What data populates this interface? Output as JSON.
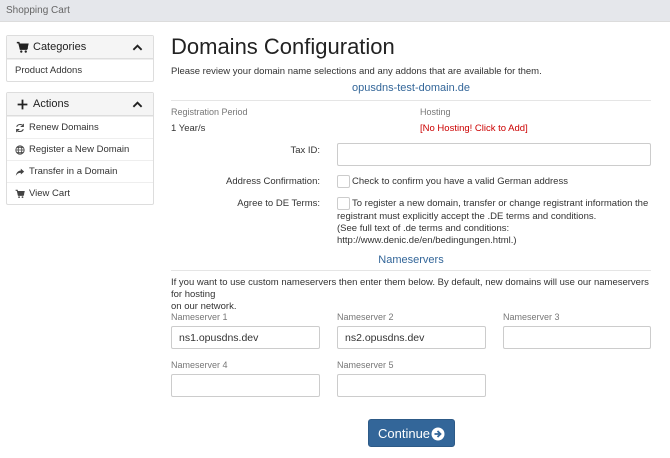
{
  "topbar": {
    "title": "Shopping Cart"
  },
  "sidebar": {
    "categories": {
      "title": "Categories",
      "items": [
        {
          "label": "Product Addons"
        }
      ]
    },
    "actions": {
      "title": "Actions",
      "items": [
        {
          "label": "Renew Domains",
          "icon": "refresh-icon"
        },
        {
          "label": "Register a New Domain",
          "icon": "globe-icon"
        },
        {
          "label": "Transfer in a Domain",
          "icon": "share-arrow-icon"
        },
        {
          "label": "View Cart",
          "icon": "cart-icon"
        }
      ]
    }
  },
  "main": {
    "title": "Domains Configuration",
    "subtitle": "Please review your domain name selections and any addons that are available for them.",
    "domain": "opusdns-test-domain.de",
    "registration_period_label": "Registration Period",
    "registration_period_value": "1 Year/s",
    "hosting_label": "Hosting",
    "hosting_value": "[No Hosting! Click to Add]",
    "tax_id_label": "Tax ID:",
    "tax_id_value": "",
    "address_confirmation_label": "Address Confirmation:",
    "address_confirmation_text": "Check to confirm you have a valid German address",
    "agree_terms_label": "Agree to DE Terms:",
    "agree_terms_line1": "To register a new domain, transfer or change registrant information the",
    "agree_terms_line2": "registrant must explicitly accept the .DE terms and conditions.",
    "agree_terms_line3": "(See full text of .de terms and conditions:",
    "agree_terms_line4": "http://www.denic.de/en/bedingungen.html.)"
  },
  "nameservers": {
    "header": "Nameservers",
    "description_line1": "If you want to use custom nameservers then enter them below. By default, new domains will use our nameservers for hosting",
    "description_line2": "on our network.",
    "fields": [
      {
        "label": "Nameserver 1",
        "value": "ns1.opusdns.dev"
      },
      {
        "label": "Nameserver 2",
        "value": "ns2.opusdns.dev"
      },
      {
        "label": "Nameserver 3",
        "value": ""
      },
      {
        "label": "Nameserver 4",
        "value": ""
      },
      {
        "label": "Nameserver 5",
        "value": ""
      }
    ]
  },
  "continue_button": {
    "label": "Continue"
  },
  "colors": {
    "accent": "#336699",
    "warning": "#cc0000",
    "panel_bg": "#f5f5f5"
  }
}
